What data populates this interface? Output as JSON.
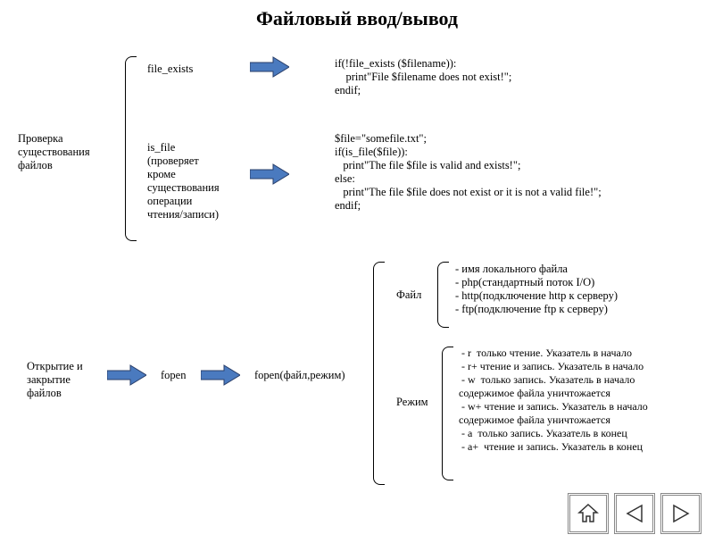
{
  "title": "Файловый ввод/вывод",
  "section1": {
    "label": "Проверка\nсуществования\nфайлов",
    "func1": "file_exists",
    "code1": "if(!file_exists ($filename)):\n    print\"File $filename does not exist!\";\nendif;",
    "func2": "is_file\n(проверяет\nкроме\nсуществования\nоперации\nчтения/записи)",
    "code2": "$file=\"somefile.txt\";\nif(is_file($file)):\n   print\"The file $file is valid and exists!\";\nelse:\n   print\"The file $file does not exist or it is not a valid file!\";\nendif;"
  },
  "section2": {
    "label": "Открытие и\nзакрытие\nфайлов",
    "func": "fopen",
    "call": "fopen(файл,режим)",
    "file_label": "Файл",
    "file_items": "- имя локального файла\n- php(стандартный поток I/O)\n- http(подключение http к серверу)\n- ftp(подключение ftp к серверу)",
    "mode_label": "Режим",
    "mode_items": " - r  только чтение. Указатель в начало\n - r+ чтение и запись. Указатель в начало\n - w  только запись. Указатель в начало\nсодержимое файла уничтожается\n - w+ чтение и запись. Указатель в начало\nсодержимое файла уничтожается\n - a  только запись. Указатель в конец\n - a+  чтение и запись. Указатель в конец"
  },
  "nav": {
    "home": "home-icon",
    "prev": "prev-icon",
    "next": "next-icon"
  }
}
